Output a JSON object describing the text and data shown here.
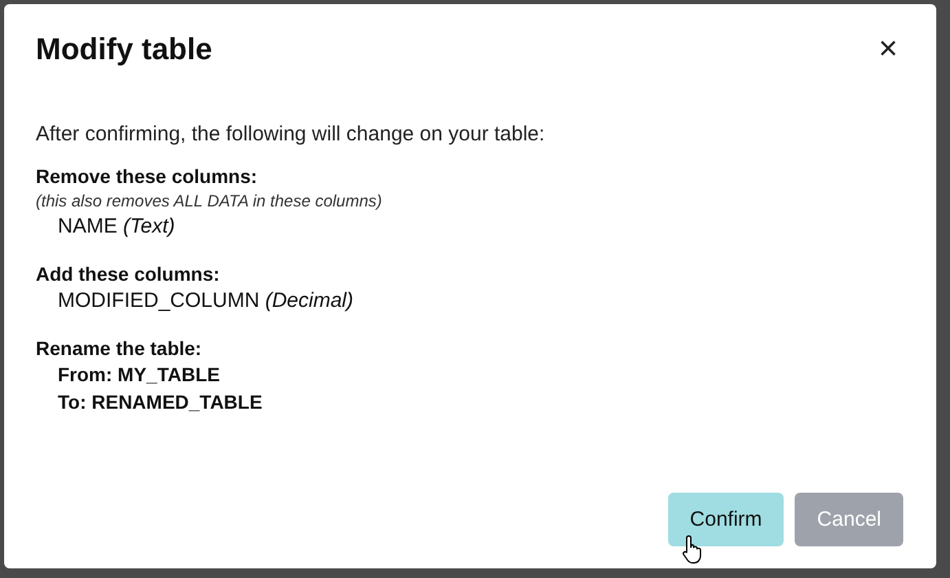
{
  "dialog": {
    "title": "Modify table",
    "close": "×",
    "intro": "After confirming, the following will change on your table:",
    "sections": [
      {
        "heading": "Remove these columns:",
        "note": "(this also removes ALL DATA in these columns)",
        "items": [
          {
            "text": "NAME *(Text)*",
            "bold": false
          }
        ]
      },
      {
        "heading": "Add these columns:",
        "items": [
          {
            "text": "MODIFIED_COLUMN *(Decimal)*",
            "bold": false
          }
        ]
      },
      {
        "heading": "Rename the table:",
        "items": [
          {
            "text": "From: MY_TABLE",
            "bold": true
          },
          {
            "text": "To: RENAMED_TABLE",
            "bold": true
          }
        ]
      }
    ],
    "buttons": [
      {
        "label": "Confirm",
        "kind": "primary",
        "hovered": true
      },
      {
        "label": "Cancel",
        "kind": "secondary",
        "hovered": false
      }
    ]
  }
}
